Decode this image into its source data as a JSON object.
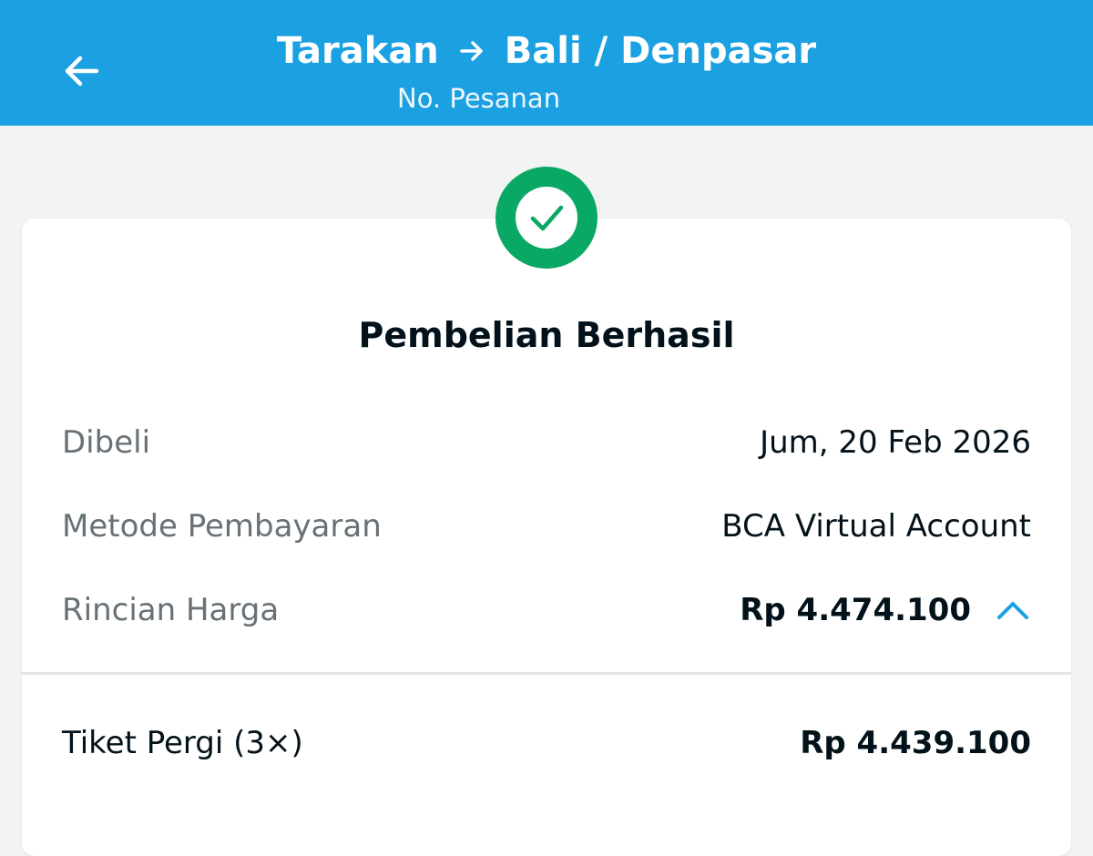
{
  "header": {
    "origin": "Tarakan",
    "destination": "Bali / Denpasar",
    "order_label": "No. Pesanan",
    "back_icon": "arrow-left-icon",
    "route_icon": "arrow-right-icon",
    "background_color": "#1BA0E2"
  },
  "status": {
    "icon": "check-circle-icon",
    "color": "#0AA865",
    "title": "Pembelian Berhasil"
  },
  "details": {
    "purchased_label": "Dibeli",
    "purchased_value": "Jum, 20 Feb 2026",
    "payment_label": "Metode Pembayaran",
    "payment_value": "BCA Virtual Account",
    "price_label": "Rincian Harga",
    "price_value": "Rp 4.474.100",
    "price_toggle_icon": "chevron-up-icon"
  },
  "breakdown": {
    "items": [
      {
        "label": "Tiket Pergi (3×)",
        "value": "Rp 4.439.100"
      }
    ]
  }
}
